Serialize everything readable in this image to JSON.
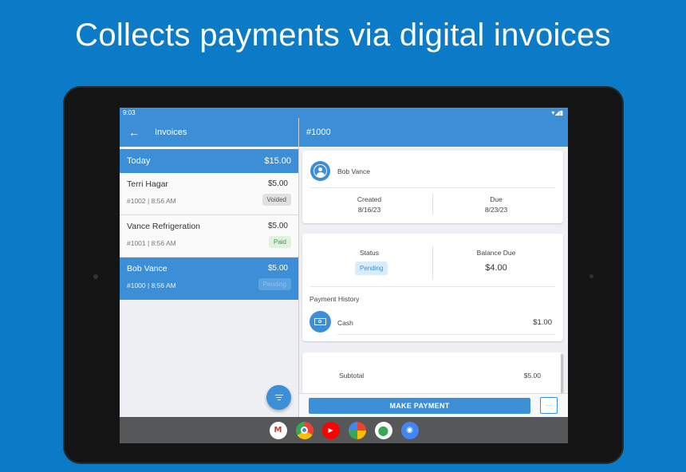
{
  "headline": "Collects payments via digital invoices",
  "statusbar": {
    "time": "9:03",
    "signal": "▾◢▮"
  },
  "left": {
    "title": "Invoices",
    "group": {
      "label": "Today",
      "total": "$15.00"
    },
    "invoices": [
      {
        "name": "Terri Hagar",
        "amount": "$5.00",
        "meta": "#1002 | 8:56 AM",
        "status": "Voided"
      },
      {
        "name": "Vance Refrigeration",
        "amount": "$5.00",
        "meta": "#1001 | 8:56 AM",
        "status": "Paid"
      },
      {
        "name": "Bob Vance",
        "amount": "$5.00",
        "meta": "#1000 | 8:56 AM",
        "status": "Pending"
      }
    ]
  },
  "detail": {
    "title": "#1000",
    "customer": "Bob Vance",
    "created_label": "Created",
    "created_value": "8/16/23",
    "due_label": "Due",
    "due_value": "8/23/23",
    "status_label": "Status",
    "status_value": "Pending",
    "balance_label": "Balance Due",
    "balance_value": "$4.00",
    "payment_history_label": "Payment History",
    "payments": [
      {
        "method": "Cash",
        "amount": "$1.00"
      }
    ],
    "subtotal_label": "Subtotal",
    "subtotal_value": "$5.00",
    "make_payment_label": "MAKE PAYMENT",
    "more_label": "···"
  },
  "apps": [
    "M",
    "",
    "▶",
    "",
    "⬤",
    "◉"
  ],
  "colors": {
    "primary": "#3c8fd6",
    "background": "#0b7bc7"
  }
}
